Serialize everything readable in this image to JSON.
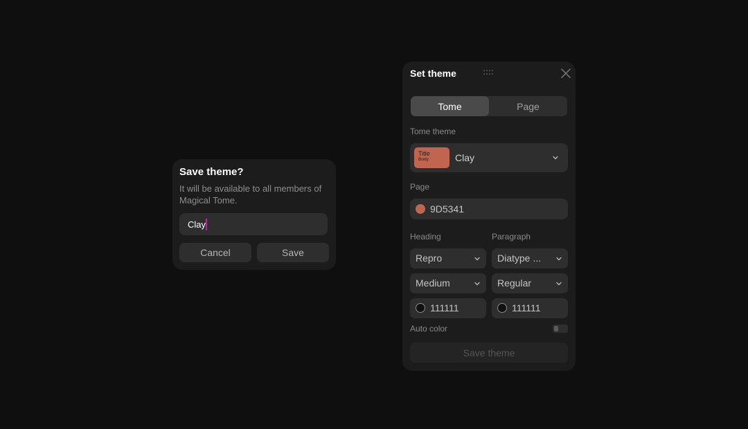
{
  "save_dialog": {
    "title": "Save theme?",
    "description": "It will be available to all members of Magical Tome.",
    "input_value": "Clay",
    "cancel_label": "Cancel",
    "save_label": "Save",
    "caret_color": "#c21fa3"
  },
  "theme_panel": {
    "title": "Set theme",
    "tabs": [
      {
        "label": "Tome",
        "active": true
      },
      {
        "label": "Page",
        "active": false
      }
    ],
    "tome_theme_label": "Tome theme",
    "tome_theme": {
      "swatch_title": "Title",
      "swatch_body": "Body",
      "name": "Clay",
      "swatch_color": "#c0654f"
    },
    "page_label": "Page",
    "page_color": {
      "value": "9D5341",
      "color": "#c0654f"
    },
    "heading_label": "Heading",
    "paragraph_label": "Paragraph",
    "heading_font": "Repro",
    "paragraph_font": "Diatype ...",
    "heading_weight": "Medium",
    "paragraph_weight": "Regular",
    "heading_color": {
      "value": "111111",
      "color": "#111111"
    },
    "paragraph_color": {
      "value": "111111",
      "color": "#111111"
    },
    "auto_color_label": "Auto color",
    "auto_color_on": false,
    "save_theme_label": "Save theme"
  }
}
